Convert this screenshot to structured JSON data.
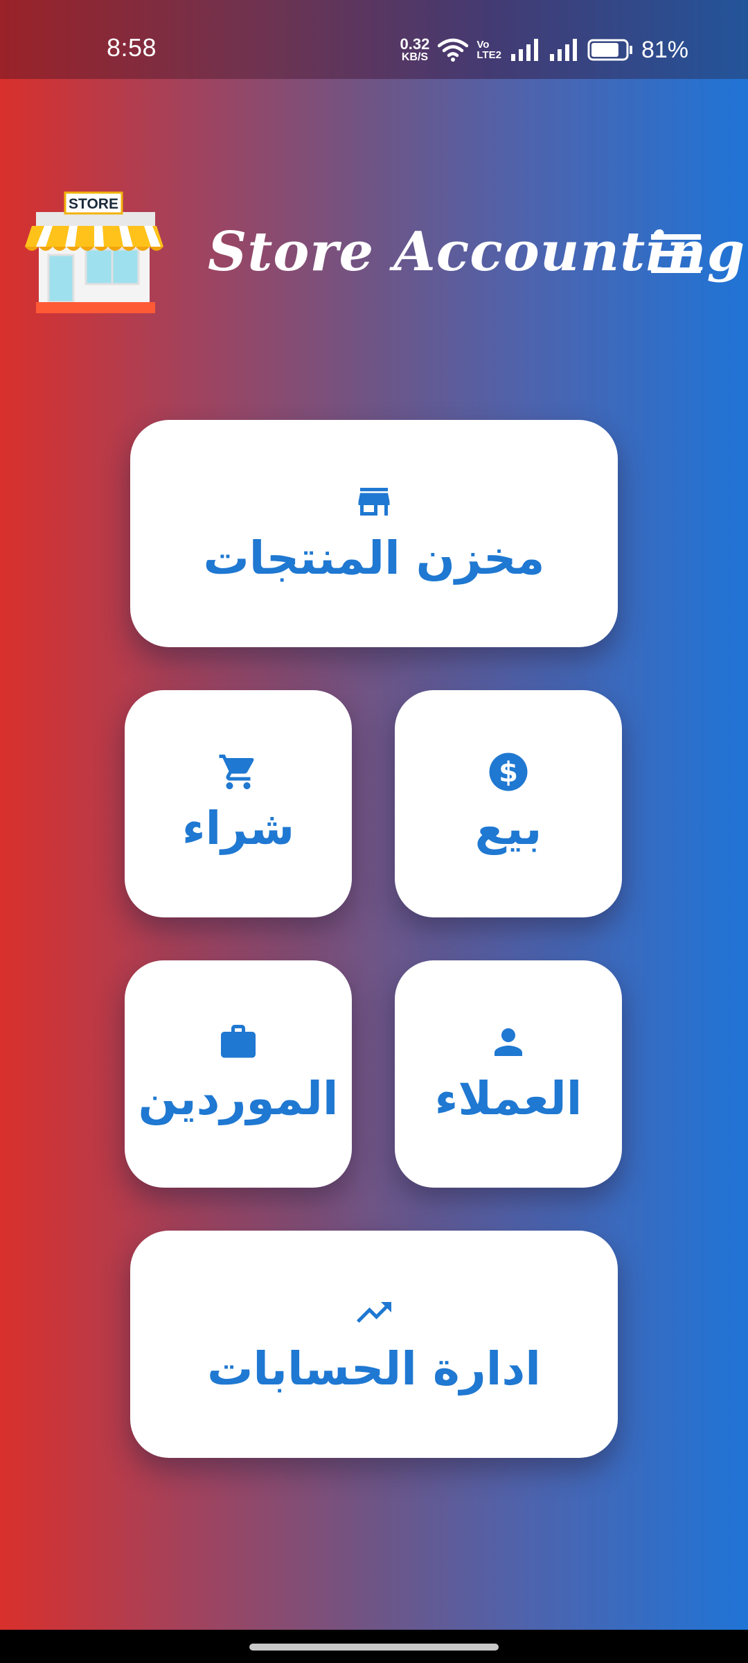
{
  "status_bar": {
    "time": "8:58",
    "net_speed_value": "0.32",
    "net_speed_unit": "KB/S",
    "volte_top": "Vo",
    "volte_bottom": "LTE2",
    "battery_percent": "81%",
    "battery_level": 0.81
  },
  "header": {
    "logo_sign": "STORE",
    "title": "Store Accounting",
    "menu_icon": "hamburger-menu-icon"
  },
  "cards": {
    "products": {
      "icon": "store-icon",
      "label": "مخزن المنتجات"
    },
    "purchase": {
      "icon": "cart-icon",
      "label": "شراء"
    },
    "sale": {
      "icon": "dollar-icon",
      "label": "بيع"
    },
    "suppliers": {
      "icon": "briefcase-icon",
      "label": "الموردين"
    },
    "customers": {
      "icon": "person-icon",
      "label": "العملاء"
    },
    "accounts": {
      "icon": "trending-up-icon",
      "label": "ادارة الحسابات"
    }
  },
  "colors": {
    "accent": "#1f78d1",
    "gradient_left": "#d8302c",
    "gradient_right": "#1f74d6",
    "card_bg": "#ffffff"
  }
}
